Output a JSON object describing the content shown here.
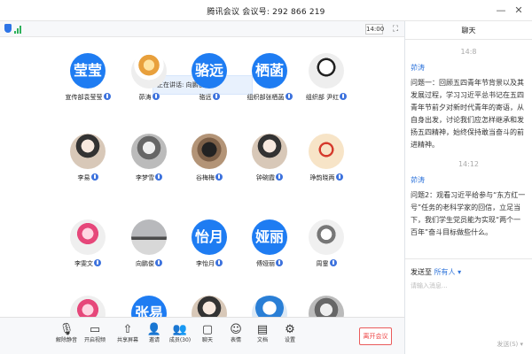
{
  "window": {
    "title": "腾讯会议  会议号: 292 866 219"
  },
  "toolstrip": {
    "time": "14:00"
  },
  "speaking": {
    "text": "正在讲话: 向鹏俊;"
  },
  "participants": [
    {
      "name": "宣传部袁莹莹",
      "avatar": "莹莹",
      "type": "text"
    },
    {
      "name": "茆涛",
      "avatar": "",
      "type": "photo",
      "style": "cake"
    },
    {
      "name": "骆远",
      "avatar": "骆远",
      "type": "text"
    },
    {
      "name": "组织部张栖菡",
      "avatar": "栖菡",
      "type": "text"
    },
    {
      "name": "组织部 尹红",
      "avatar": "",
      "type": "photo",
      "style": "bw"
    },
    {
      "name": "李易",
      "avatar": "",
      "type": "photo",
      "style": "photo"
    },
    {
      "name": "李梦雪",
      "avatar": "",
      "type": "photo",
      "style": "gray"
    },
    {
      "name": "谷梅梅",
      "avatar": "",
      "type": "photo",
      "style": "dark"
    },
    {
      "name": "钟碗霞",
      "avatar": "",
      "type": "photo",
      "style": "photo"
    },
    {
      "name": "琤韵晓两",
      "avatar": "",
      "type": "photo",
      "style": "red"
    },
    {
      "name": "李雯文",
      "avatar": "",
      "type": "photo",
      "style": "party"
    },
    {
      "name": "向鹏俊",
      "avatar": "",
      "type": "photo",
      "style": "sea"
    },
    {
      "name": "李怡月",
      "avatar": "怡月",
      "type": "text"
    },
    {
      "name": "傅娅丽",
      "avatar": "娅丽",
      "type": "text"
    },
    {
      "name": "周霊",
      "avatar": "",
      "type": "photo",
      "style": "mask"
    },
    {
      "name": "",
      "avatar": "",
      "type": "photo",
      "style": "party"
    },
    {
      "name": "",
      "avatar": "张易",
      "type": "text"
    },
    {
      "name": "",
      "avatar": "",
      "type": "photo",
      "style": "photo"
    },
    {
      "name": "",
      "avatar": "",
      "type": "photo",
      "style": "blue"
    },
    {
      "name": "",
      "avatar": "",
      "type": "photo",
      "style": "gray"
    }
  ],
  "toolbar": {
    "mute": "解除静音",
    "video": "开启视频",
    "share": "共享屏幕",
    "invite": "邀请",
    "members": "成员(30)",
    "chat": "聊天",
    "emoji": "表情",
    "docs": "文档",
    "settings": "设置",
    "leave": "离开会议"
  },
  "chat": {
    "title": "聊天",
    "messages": [
      {
        "time": "14:8",
        "sender": "茆涛",
        "text": "问题一：回顾五四青年节背景以及其发展过程，学习习近平总书记在五四青年节前夕对新时代青年的寄语，从自身出发，讨论我们应怎样继承和发扬五四精神，始终保持敢当奋斗的前进精神。"
      },
      {
        "time": "14:12",
        "sender": "茆涛",
        "text": "问题2：观看习近平给参与“东方红一号”任务的老科学家的回信，立足当下，我们学生党员能为实现“两个一百年”奋斗目标做些什么。"
      }
    ],
    "send_to_label": "发送至",
    "send_to_target": "所有人",
    "input_placeholder": "请输入消息...",
    "send_button": "发送(S)"
  }
}
